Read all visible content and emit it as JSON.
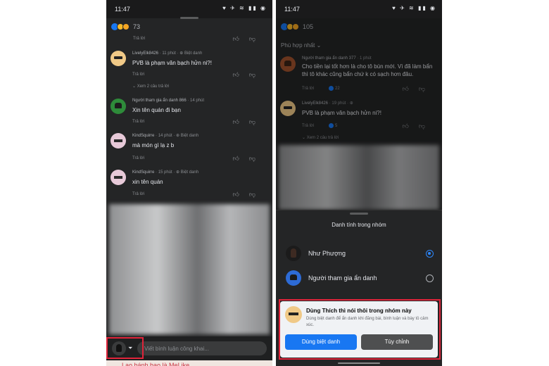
{
  "left": {
    "time": "11:47",
    "reaction_count": "73",
    "reply_label": "Trả lời",
    "comments": [
      {
        "name": "LivelyElk8426",
        "meta": "· 11 phút · ⊕ Biệt danh",
        "text": "PVB là phạm văn bạch hửn ni?!",
        "see_replies": "⌄ Xem 2 câu trả lời"
      },
      {
        "name": "Người tham gia ẩn danh 866",
        "meta": "· 14 phút",
        "text": "Xin tên quán đi bạn"
      },
      {
        "name": "KindSquirre",
        "meta": "· 14 phút · ⊕ Biệt danh",
        "text": "mà món gì lạ z b"
      },
      {
        "name": "KindSquirre",
        "meta": "· 15 phút · ⊕ Biệt danh",
        "text": "xin tên quán"
      }
    ],
    "composer_placeholder": "Viết bình luận công khai...",
    "bottom_cut_text": "Lạo bánh bao là MeLike"
  },
  "right": {
    "time": "11:47",
    "reaction_count": "105",
    "sort_label": "Phù hợp nhất ⌄",
    "reply_label": "Trả lời",
    "comments": [
      {
        "name": "Người tham gia ẩn danh 377",
        "meta": "· 1 phút",
        "text": "Cho tiền lại tốt hơn là cho tô bún mới. Vì đã làm bẩn thì tô khác cũng bẩn chứ k có sạch hơn đâu.",
        "likes": "22"
      },
      {
        "name": "LivelyElk8426",
        "meta": "· 19 phút · ⊕",
        "text": "PVB là phạm văn bạch hửn ni?!",
        "likes": "5",
        "see_replies": "⌄ Xem 2 câu trả lời"
      }
    ],
    "sheet": {
      "title": "Danh tính trong nhóm",
      "options": [
        {
          "label": "Như Phượng",
          "selected": true
        },
        {
          "label": "Người tham gia ẩn danh",
          "selected": false
        }
      ]
    },
    "promo": {
      "title": "Dùng Thích thì nói thôi trong nhóm này",
      "description": "Dùng biệt danh để ẩn danh khi đăng bài, bình luận và bày tỏ cảm xúc.",
      "primary_button": "Dùng biệt danh",
      "secondary_button": "Tùy chỉnh"
    }
  },
  "colors": {
    "highlight": "#e0243a",
    "accent": "#1877f2"
  }
}
